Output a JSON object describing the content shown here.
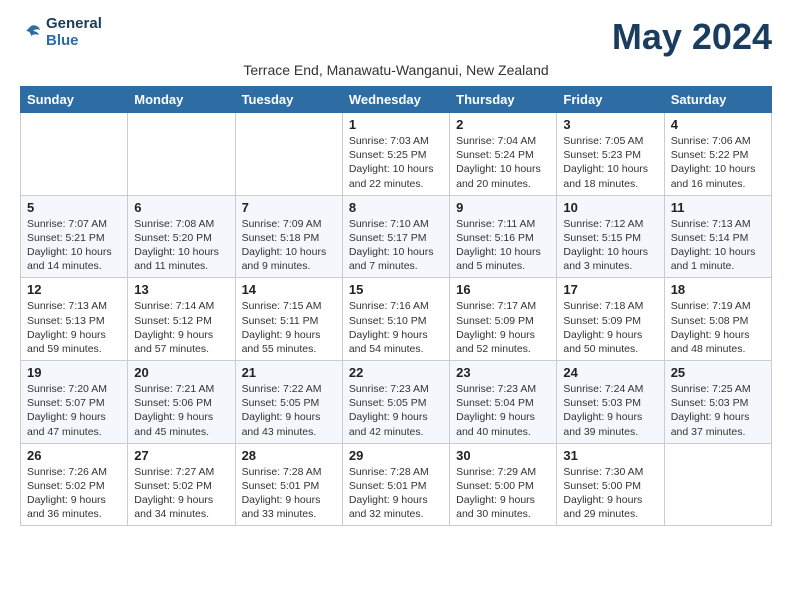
{
  "header": {
    "logo_line1": "General",
    "logo_line2": "Blue",
    "month_title": "May 2024",
    "subtitle": "Terrace End, Manawatu-Wanganui, New Zealand"
  },
  "weekdays": [
    "Sunday",
    "Monday",
    "Tuesday",
    "Wednesday",
    "Thursday",
    "Friday",
    "Saturday"
  ],
  "weeks": [
    [
      {
        "day": "",
        "info": ""
      },
      {
        "day": "",
        "info": ""
      },
      {
        "day": "",
        "info": ""
      },
      {
        "day": "1",
        "info": "Sunrise: 7:03 AM\nSunset: 5:25 PM\nDaylight: 10 hours\nand 22 minutes."
      },
      {
        "day": "2",
        "info": "Sunrise: 7:04 AM\nSunset: 5:24 PM\nDaylight: 10 hours\nand 20 minutes."
      },
      {
        "day": "3",
        "info": "Sunrise: 7:05 AM\nSunset: 5:23 PM\nDaylight: 10 hours\nand 18 minutes."
      },
      {
        "day": "4",
        "info": "Sunrise: 7:06 AM\nSunset: 5:22 PM\nDaylight: 10 hours\nand 16 minutes."
      }
    ],
    [
      {
        "day": "5",
        "info": "Sunrise: 7:07 AM\nSunset: 5:21 PM\nDaylight: 10 hours\nand 14 minutes."
      },
      {
        "day": "6",
        "info": "Sunrise: 7:08 AM\nSunset: 5:20 PM\nDaylight: 10 hours\nand 11 minutes."
      },
      {
        "day": "7",
        "info": "Sunrise: 7:09 AM\nSunset: 5:18 PM\nDaylight: 10 hours\nand 9 minutes."
      },
      {
        "day": "8",
        "info": "Sunrise: 7:10 AM\nSunset: 5:17 PM\nDaylight: 10 hours\nand 7 minutes."
      },
      {
        "day": "9",
        "info": "Sunrise: 7:11 AM\nSunset: 5:16 PM\nDaylight: 10 hours\nand 5 minutes."
      },
      {
        "day": "10",
        "info": "Sunrise: 7:12 AM\nSunset: 5:15 PM\nDaylight: 10 hours\nand 3 minutes."
      },
      {
        "day": "11",
        "info": "Sunrise: 7:13 AM\nSunset: 5:14 PM\nDaylight: 10 hours\nand 1 minute."
      }
    ],
    [
      {
        "day": "12",
        "info": "Sunrise: 7:13 AM\nSunset: 5:13 PM\nDaylight: 9 hours\nand 59 minutes."
      },
      {
        "day": "13",
        "info": "Sunrise: 7:14 AM\nSunset: 5:12 PM\nDaylight: 9 hours\nand 57 minutes."
      },
      {
        "day": "14",
        "info": "Sunrise: 7:15 AM\nSunset: 5:11 PM\nDaylight: 9 hours\nand 55 minutes."
      },
      {
        "day": "15",
        "info": "Sunrise: 7:16 AM\nSunset: 5:10 PM\nDaylight: 9 hours\nand 54 minutes."
      },
      {
        "day": "16",
        "info": "Sunrise: 7:17 AM\nSunset: 5:09 PM\nDaylight: 9 hours\nand 52 minutes."
      },
      {
        "day": "17",
        "info": "Sunrise: 7:18 AM\nSunset: 5:09 PM\nDaylight: 9 hours\nand 50 minutes."
      },
      {
        "day": "18",
        "info": "Sunrise: 7:19 AM\nSunset: 5:08 PM\nDaylight: 9 hours\nand 48 minutes."
      }
    ],
    [
      {
        "day": "19",
        "info": "Sunrise: 7:20 AM\nSunset: 5:07 PM\nDaylight: 9 hours\nand 47 minutes."
      },
      {
        "day": "20",
        "info": "Sunrise: 7:21 AM\nSunset: 5:06 PM\nDaylight: 9 hours\nand 45 minutes."
      },
      {
        "day": "21",
        "info": "Sunrise: 7:22 AM\nSunset: 5:05 PM\nDaylight: 9 hours\nand 43 minutes."
      },
      {
        "day": "22",
        "info": "Sunrise: 7:23 AM\nSunset: 5:05 PM\nDaylight: 9 hours\nand 42 minutes."
      },
      {
        "day": "23",
        "info": "Sunrise: 7:23 AM\nSunset: 5:04 PM\nDaylight: 9 hours\nand 40 minutes."
      },
      {
        "day": "24",
        "info": "Sunrise: 7:24 AM\nSunset: 5:03 PM\nDaylight: 9 hours\nand 39 minutes."
      },
      {
        "day": "25",
        "info": "Sunrise: 7:25 AM\nSunset: 5:03 PM\nDaylight: 9 hours\nand 37 minutes."
      }
    ],
    [
      {
        "day": "26",
        "info": "Sunrise: 7:26 AM\nSunset: 5:02 PM\nDaylight: 9 hours\nand 36 minutes."
      },
      {
        "day": "27",
        "info": "Sunrise: 7:27 AM\nSunset: 5:02 PM\nDaylight: 9 hours\nand 34 minutes."
      },
      {
        "day": "28",
        "info": "Sunrise: 7:28 AM\nSunset: 5:01 PM\nDaylight: 9 hours\nand 33 minutes."
      },
      {
        "day": "29",
        "info": "Sunrise: 7:28 AM\nSunset: 5:01 PM\nDaylight: 9 hours\nand 32 minutes."
      },
      {
        "day": "30",
        "info": "Sunrise: 7:29 AM\nSunset: 5:00 PM\nDaylight: 9 hours\nand 30 minutes."
      },
      {
        "day": "31",
        "info": "Sunrise: 7:30 AM\nSunset: 5:00 PM\nDaylight: 9 hours\nand 29 minutes."
      },
      {
        "day": "",
        "info": ""
      }
    ]
  ]
}
